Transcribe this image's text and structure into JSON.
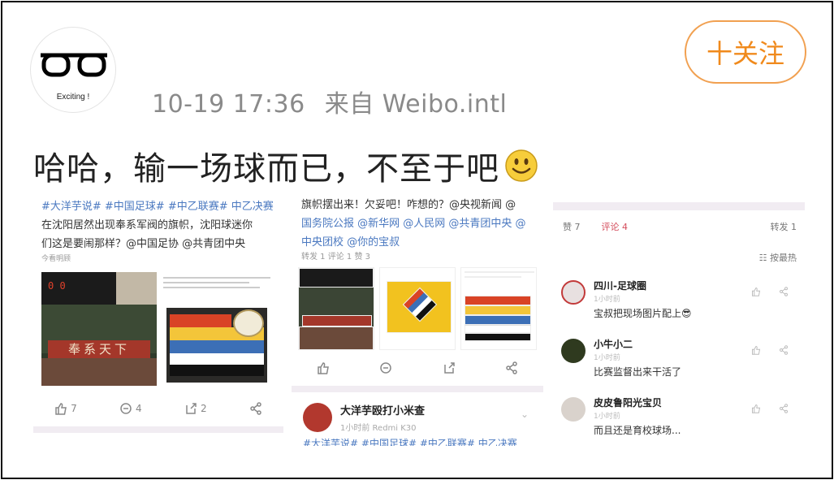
{
  "header": {
    "avatar_caption": "Exciting !",
    "date": "10-19 17:36",
    "source": "来自 Weibo.intl",
    "follow_label": "十关注"
  },
  "post": {
    "text": "哈哈，输一场球而已，不至于吧"
  },
  "panel1": {
    "text_lines": [
      "#大洋芋说# #中国足球# #中乙联赛# 中乙决赛",
      "在沈阳居然出现奉系军阀的旗帜，沈阳球迷你",
      "们这是要闹那样？@中国足协 @共青团中央"
    ],
    "reading": "今看明顾",
    "scoreboard": "0  0",
    "banner_text": "奉系天下",
    "likes": "7",
    "comments": "4",
    "shares": "2"
  },
  "panel2": {
    "text_lines": [
      "旗帜摆出来！欠妥吧！咋想的？@央视新闻 @",
      "国务院公报 @新华网 @人民网 @共青团中央 @",
      "中央团校 @你的宝叔"
    ],
    "sub": "转发 1   评论 1       赞 3",
    "commenter_name": "大洋芋殴打小米查",
    "commenter_sub": "1小时前   Redmi K30",
    "cut_text": "#大洋芋说# #中国足球# #中乙联赛# 中乙决赛"
  },
  "panel3": {
    "likes": "赞 7",
    "comments": "评论 4",
    "shares": "转发 1",
    "sort": "☷ 按最热",
    "comments_list": [
      {
        "name": "四川-足球圈",
        "time": "1小时前",
        "text": "宝叔把现场图片配上😎",
        "avatar_color": "#e8e0e0"
      },
      {
        "name": "小牛小二",
        "time": "1小时前",
        "text": "比赛监督出来干活了",
        "avatar_color": "#2f3a1f"
      },
      {
        "name": "皮皮鲁阳光宝贝",
        "time": "1小时前",
        "text": "而且还是育校球场...",
        "avatar_color": "#d9d2cc"
      }
    ]
  },
  "colors": {
    "follow_orange": "#f08a1c",
    "link_blue": "#4a78c0",
    "comment_red": "#d44c5b"
  }
}
